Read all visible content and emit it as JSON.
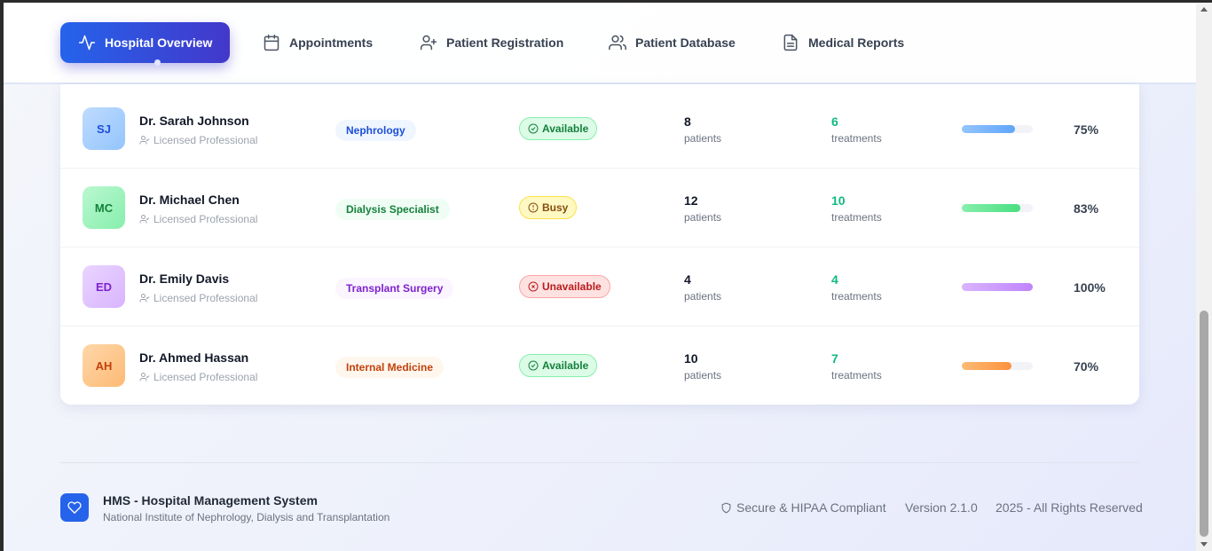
{
  "nav": {
    "items": [
      {
        "label": "Hospital Overview",
        "icon": "activity-icon",
        "active": true
      },
      {
        "label": "Appointments",
        "icon": "calendar-icon"
      },
      {
        "label": "Patient Registration",
        "icon": "user-plus-icon"
      },
      {
        "label": "Patient Database",
        "icon": "users-icon"
      },
      {
        "label": "Medical Reports",
        "icon": "file-text-icon"
      }
    ]
  },
  "doctors": [
    {
      "initials": "SJ",
      "name": "Dr. Sarah Johnson",
      "subtitle": "Licensed Professional",
      "department": "Nephrology",
      "status": "Available",
      "patients": "8",
      "patients_label": "patients",
      "treatments": "6",
      "treatments_label": "treatments",
      "progress": 75,
      "percent": "75%"
    },
    {
      "initials": "MC",
      "name": "Dr. Michael Chen",
      "subtitle": "Licensed Professional",
      "department": "Dialysis Specialist",
      "status": "Busy",
      "patients": "12",
      "patients_label": "patients",
      "treatments": "10",
      "treatments_label": "treatments",
      "progress": 83,
      "percent": "83%"
    },
    {
      "initials": "ED",
      "name": "Dr. Emily Davis",
      "subtitle": "Licensed Professional",
      "department": "Transplant Surgery",
      "status": "Unavailable",
      "patients": "4",
      "patients_label": "patients",
      "treatments": "4",
      "treatments_label": "treatments",
      "progress": 100,
      "percent": "100%"
    },
    {
      "initials": "AH",
      "name": "Dr. Ahmed Hassan",
      "subtitle": "Licensed Professional",
      "department": "Internal Medicine",
      "status": "Available",
      "patients": "10",
      "patients_label": "patients",
      "treatments": "7",
      "treatments_label": "treatments",
      "progress": 70,
      "percent": "70%"
    }
  ],
  "colors": {
    "brand_primary": "#2563eb",
    "brand_secondary": "#4338ca",
    "treatments_green": "#10b981"
  },
  "footer": {
    "title": "HMS - Hospital Management System",
    "subtitle": "National Institute of Nephrology, Dialysis and Transplantation",
    "secure": "Secure & HIPAA Compliant",
    "version": "Version 2.1.0",
    "copyright": "2025 - All Rights Reserved"
  }
}
